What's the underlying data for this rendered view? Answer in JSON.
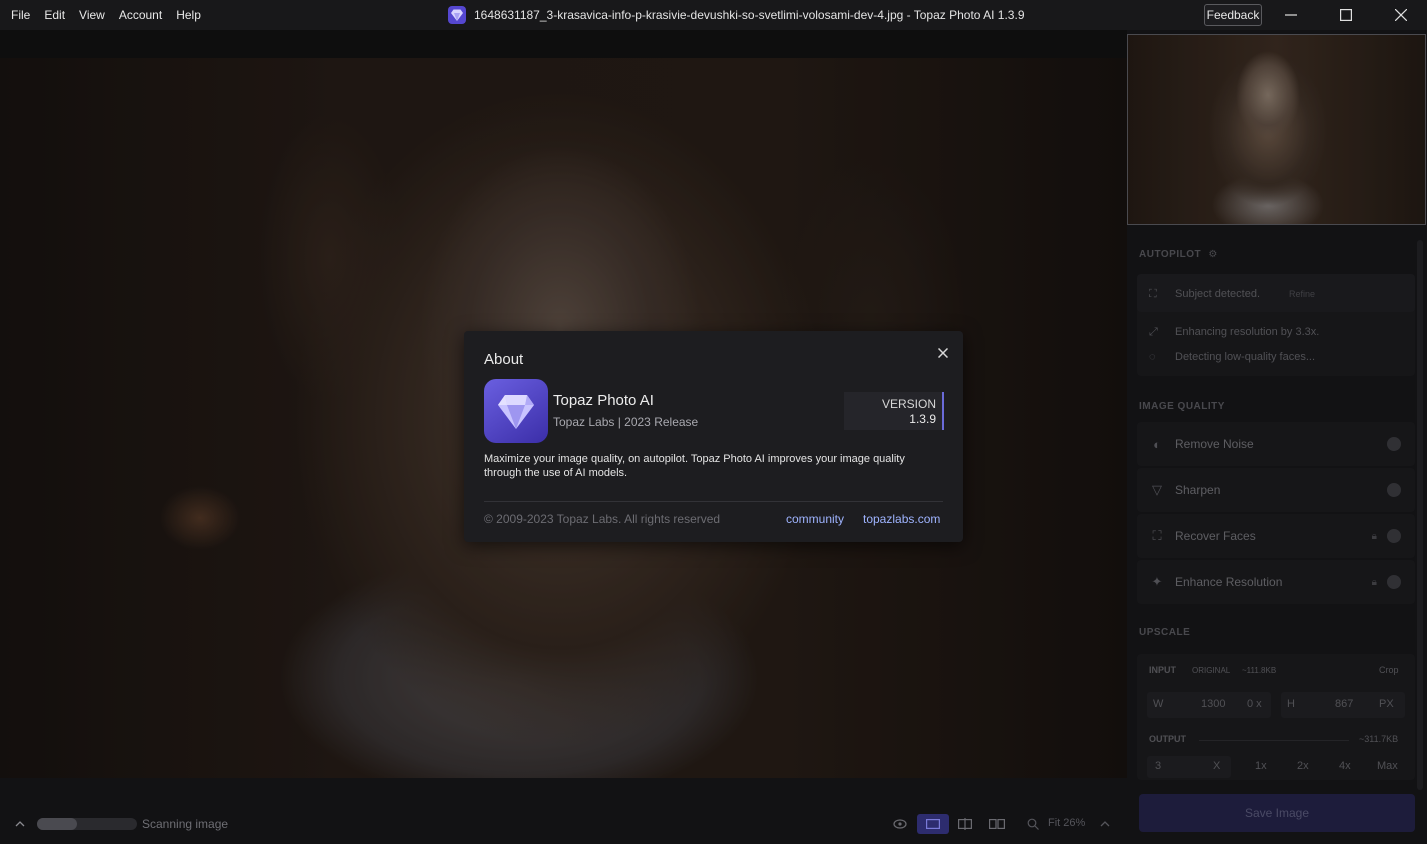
{
  "menu": [
    "File",
    "Edit",
    "View",
    "Account",
    "Help"
  ],
  "window": {
    "title": "1648631187_3-krasavica-info-p-krasivie-devushki-so-svetlimi-volosami-dev-4.jpg - Topaz Photo AI 1.3.9",
    "feedback_label": "Feedback"
  },
  "about": {
    "title": "About",
    "app_name": "Topaz Photo AI",
    "app_sub": "Topaz Labs | 2023 Release",
    "version_label": "VERSION",
    "version_number": "1.3.9",
    "description": "Maximize your image quality, on autopilot. Topaz Photo AI improves your image quality through the use of AI models.",
    "copyright": "© 2009-2023 Topaz Labs. All rights reserved",
    "link_community": "community",
    "link_site": "topazlabs.com"
  },
  "panel": {
    "autopilot_title": "AUTOPILOT",
    "subject_detected": "Subject detected.",
    "refine_label": "Refine",
    "enhancing_text": "Enhancing resolution by 3.3x.",
    "detecting_text": "Detecting low-quality faces...",
    "image_quality_title": "IMAGE QUALITY",
    "filters": [
      {
        "label": "Remove Noise",
        "icon": "remove-noise-icon"
      },
      {
        "label": "Sharpen",
        "icon": "sharpen-icon"
      },
      {
        "label": "Recover Faces",
        "icon": "recover-faces-icon"
      },
      {
        "label": "Enhance Resolution",
        "icon": "enhance-resolution-icon"
      }
    ],
    "upscale_title": "UPSCALE",
    "input_label": "INPUT",
    "original_label": "ORIGINAL",
    "input_size": "~111.8KB",
    "crop_label": "Crop",
    "w_label": "W",
    "w_value": "1300",
    "h_label": "H",
    "h_value": "867",
    "px_label": "PX",
    "output_label": "OUTPUT",
    "output_size": "~311.7KB",
    "output_value": "3",
    "x_label": "X",
    "scale_options": [
      "1x",
      "2x",
      "4x",
      "Max"
    ],
    "save_label": "Save Image"
  },
  "bottom": {
    "status": "Scanning image",
    "progress": 0.4,
    "zoom": "Fit 26%"
  }
}
